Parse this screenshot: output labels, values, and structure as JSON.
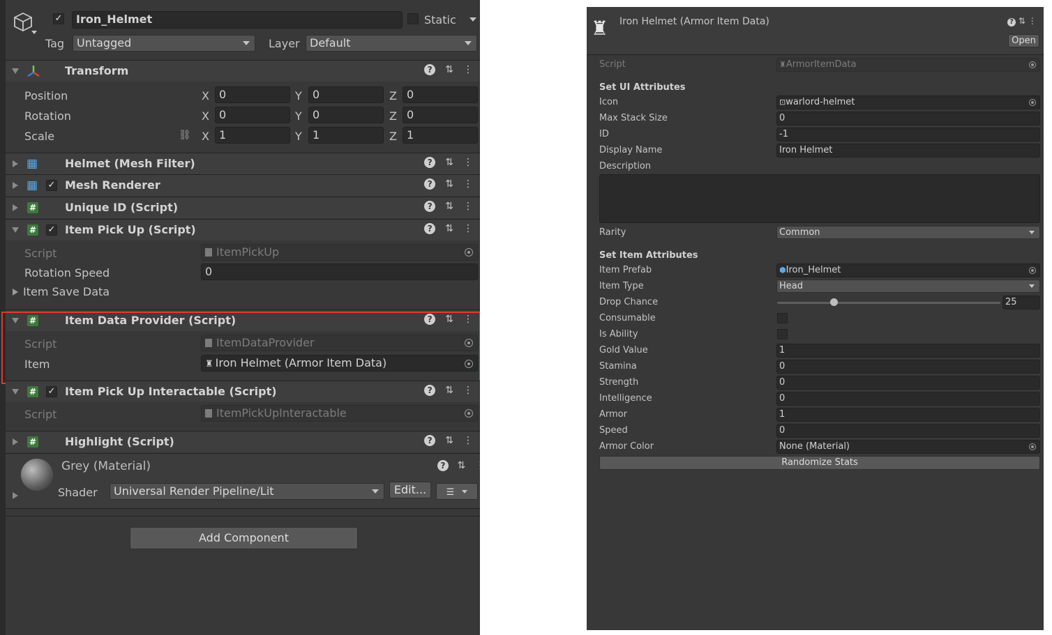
{
  "left": {
    "go_header": {
      "name": "Iron_Helmet",
      "static_label": "Static",
      "tag_label": "Tag",
      "tag_value": "Untagged",
      "layer_label": "Layer",
      "layer_value": "Default"
    },
    "transform": {
      "title": "Transform",
      "rows": [
        {
          "label": "Position",
          "x": "0",
          "y": "0",
          "z": "0"
        },
        {
          "label": "Rotation",
          "x": "0",
          "y": "0",
          "z": "0"
        },
        {
          "label": "Scale",
          "x": "1",
          "y": "1",
          "z": "1"
        }
      ],
      "axis_x": "X",
      "axis_y": "Y",
      "axis_z": "Z"
    },
    "components": {
      "mesh_filter": "Helmet (Mesh Filter)",
      "mesh_renderer": "Mesh Renderer",
      "unique_id": "Unique ID (Script)",
      "item_pick_up": "Item Pick Up (Script)",
      "item_data_provider": "Item Data Provider (Script)",
      "item_pick_up_interactable": "Item Pick Up Interactable (Script)",
      "highlight": "Highlight (Script)"
    },
    "item_pick_up": {
      "script_label": "Script",
      "script_value": "ItemPickUp",
      "rotation_speed_label": "Rotation Speed",
      "rotation_speed_value": "0",
      "save_data_label": "Item Save Data"
    },
    "item_data_provider": {
      "script_label": "Script",
      "script_value": "ItemDataProvider",
      "item_label": "Item",
      "item_value": "Iron Helmet (Armor Item Data)"
    },
    "interactable": {
      "script_label": "Script",
      "script_value": "ItemPickUpInteractable"
    },
    "material": {
      "name": "Grey (Material)",
      "shader_label": "Shader",
      "shader_value": "Universal Render Pipeline/Lit",
      "edit_label": "Edit..."
    },
    "add_component": "Add Component"
  },
  "right": {
    "title": "Iron Helmet (Armor Item Data)",
    "open_label": "Open",
    "script_label": "Script",
    "script_value": "ArmorItemData",
    "section_ui": "Set UI Attributes",
    "icon_label": "Icon",
    "icon_value": "warlord-helmet",
    "max_stack_label": "Max Stack Size",
    "max_stack_value": "0",
    "id_label": "ID",
    "id_value": "-1",
    "display_name_label": "Display Name",
    "display_name_value": "Iron Helmet",
    "description_label": "Description",
    "rarity_label": "Rarity",
    "rarity_value": "Common",
    "section_item": "Set Item Attributes",
    "item_prefab_label": "Item Prefab",
    "item_prefab_value": "Iron_Helmet",
    "item_type_label": "Item Type",
    "item_type_value": "Head",
    "drop_chance_label": "Drop Chance",
    "drop_chance_value": "25",
    "consumable_label": "Consumable",
    "is_ability_label": "Is Ability",
    "gold_value_label": "Gold Value",
    "gold_value_value": "1",
    "stamina_label": "Stamina",
    "stamina_value": "0",
    "strength_label": "Strength",
    "strength_value": "0",
    "intelligence_label": "Intelligence",
    "intelligence_value": "0",
    "armor_label": "Armor",
    "armor_value": "1",
    "speed_label": "Speed",
    "speed_value": "0",
    "armor_color_label": "Armor Color",
    "armor_color_value": "None (Material)",
    "randomize_label": "Randomize Stats"
  },
  "colors": {
    "highlight_box": "#e03a2f",
    "panel_bg": "#383838",
    "script_icon": "#3c7a3c"
  }
}
